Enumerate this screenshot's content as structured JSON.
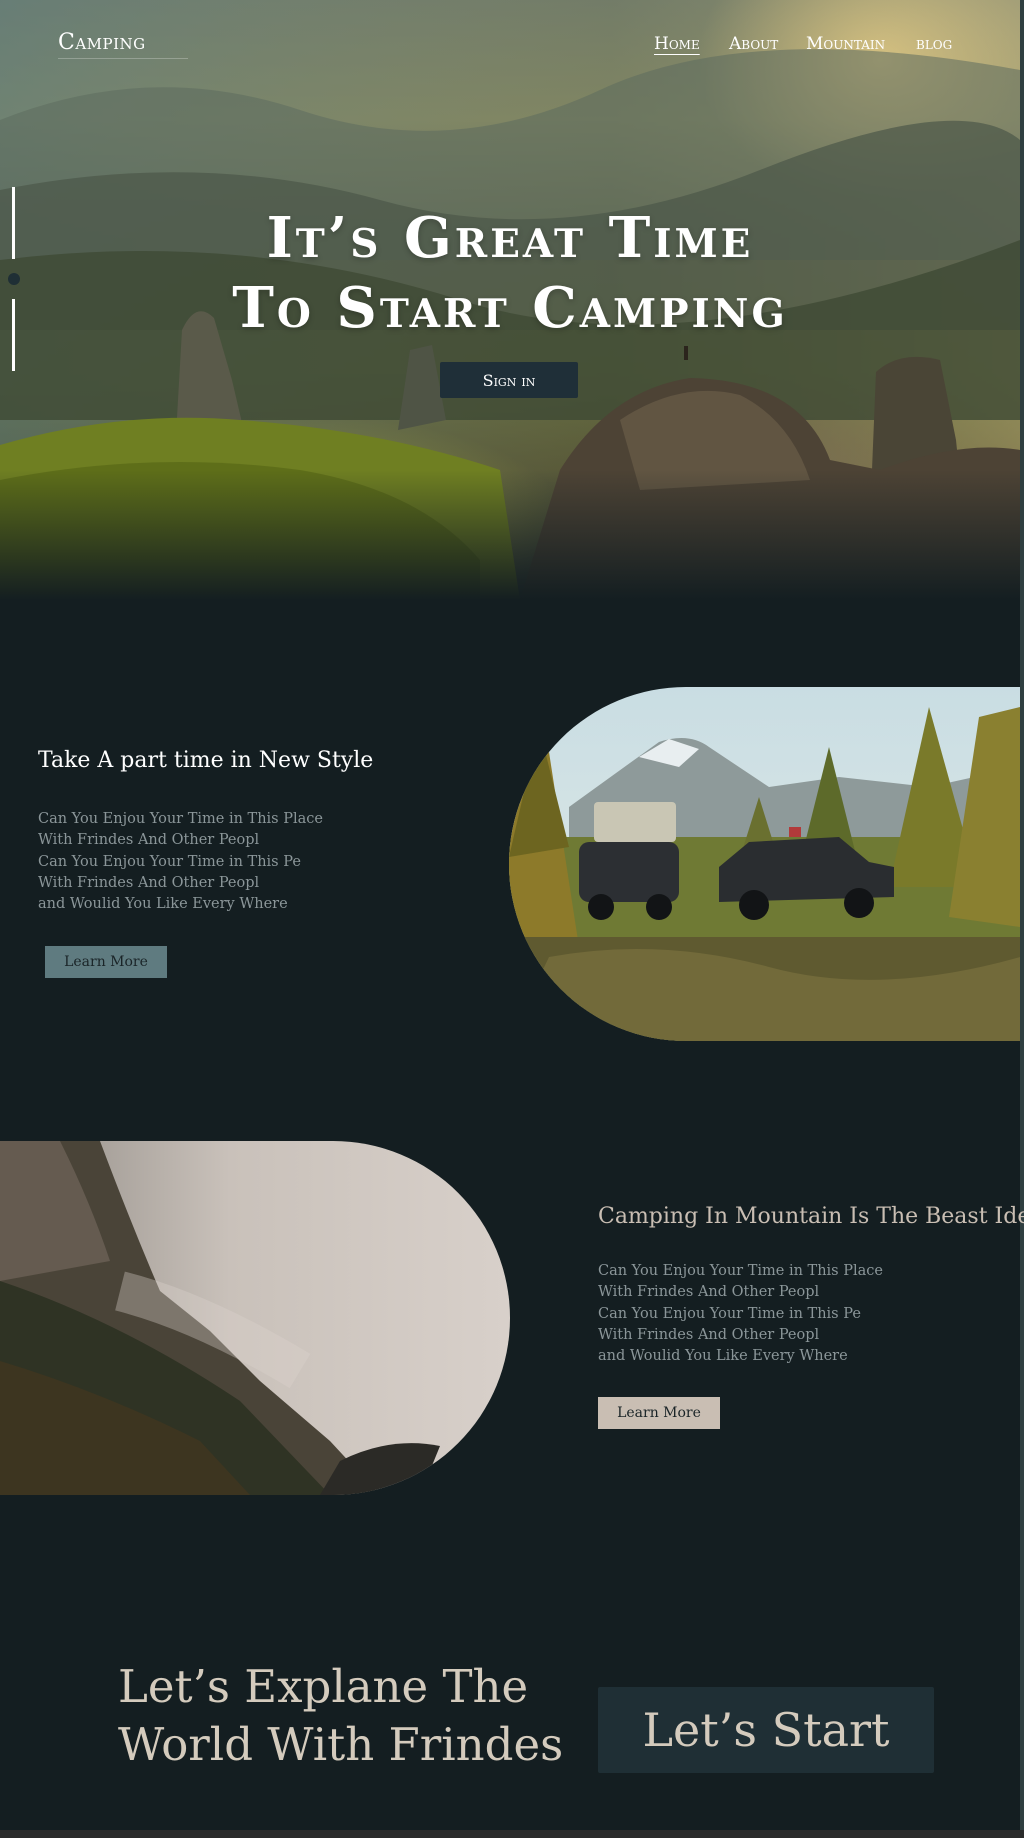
{
  "header": {
    "logo": "Camping",
    "nav": [
      {
        "label": "Home",
        "active": true
      },
      {
        "label": "About",
        "active": false
      },
      {
        "label": "Mountain",
        "active": false
      },
      {
        "label": "blog",
        "active": false
      }
    ]
  },
  "hero": {
    "title_line1": "It’s Great Time",
    "title_line2": "To Start Camping",
    "signin_label": "Sign in",
    "slider_active_index": 1
  },
  "section1": {
    "title": "Take A part time in New Style",
    "lines": [
      "Can You Enjou Your Time in This Place",
      "With Frindes And Other Peopl",
      "Can You Enjou Your Time in This Pe",
      "With Frindes And Other Peopl",
      "and Woulid You Like Every Where"
    ],
    "button_label": "Learn More",
    "button_color": "#5f7b80"
  },
  "section2": {
    "title": "Camping In Mountain Is The Beast Idea",
    "lines": [
      "Can You Enjou Your Time in This Place",
      "With Frindes And Other Peopl",
      "Can You Enjou Your Time in This Pe",
      "With Frindes And Other Peopl",
      "and Woulid You Like Every Where"
    ],
    "button_label": "Learn More",
    "button_color": "#c9beb3"
  },
  "cta": {
    "title_line1": "Let’s Explane The",
    "title_line2": "World With Frindes",
    "button_label": "Let’s Start"
  },
  "colors": {
    "background": "#141e21",
    "accent_dark": "#1f2f35",
    "beige_text": "#d4cbbd"
  }
}
